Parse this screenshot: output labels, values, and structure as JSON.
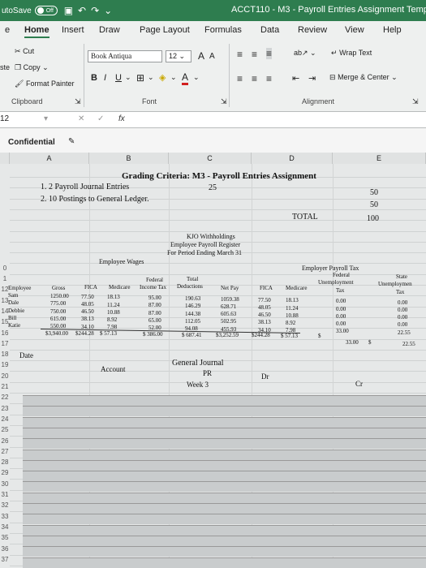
{
  "titlebar": {
    "autosave_label": "utoSave",
    "toggle_label": "Off",
    "title": "ACCT110 - M3 - Payroll Entries Assignment Template"
  },
  "tabs": [
    "e",
    "Home",
    "Insert",
    "Draw",
    "Page Layout",
    "Formulas",
    "Data",
    "Review",
    "View",
    "Help"
  ],
  "ribbon": {
    "clipboard": {
      "cut": "Cut",
      "copy": "Copy",
      "paste_partial": "ste",
      "format_painter": "Format Painter",
      "label": "Clipboard"
    },
    "font": {
      "family": "Book Antiqua",
      "size": "12",
      "grow": "A",
      "shrink": "A",
      "bold": "B",
      "italic": "I",
      "underline": "U",
      "font_color": "A",
      "fill_color": "A",
      "label": "Font"
    },
    "alignment": {
      "wrap_text": "Wrap Text",
      "merge_center": "Merge & Center",
      "label": "Alignment"
    }
  },
  "formula_bar": {
    "name_box": "12",
    "cancel": "✕",
    "enter": "✓",
    "fx": "fx",
    "value": ""
  },
  "sensitivity": {
    "label": "Confidential"
  },
  "columns": [
    "A",
    "B",
    "C",
    "D",
    "E"
  ],
  "rows": [
    "",
    "",
    "",
    "",
    "",
    "",
    "",
    "",
    "",
    "0",
    "1",
    "12",
    "13",
    "14",
    "15",
    "16",
    "17",
    "18",
    "19",
    "20",
    "21",
    "22",
    "23",
    "24",
    "25",
    "26",
    "27",
    "28",
    "29",
    "30",
    "31",
    "32",
    "33",
    "34",
    "35",
    "36",
    "37"
  ],
  "sheet": {
    "grading_title": "Grading Criteria: M3 - Payroll Entries Assignment",
    "criteria": [
      {
        "text": "1. 2 Payroll Journal Entries",
        "score": "25",
        "points": "50"
      },
      {
        "text": "2. 10 Postings to General Ledger.",
        "points": "50"
      }
    ],
    "total_label": "TOTAL",
    "total_value": "100",
    "register_lines": [
      "KJO Withholdings",
      "Employee Payroll Register",
      "For Period Ending March 31"
    ],
    "employee_wages_label": "Employee Wages",
    "employer_tax_label": "Employer Payroll Tax",
    "headers": {
      "employee": "Employee",
      "gross": "Gross",
      "fica": "FICA",
      "medicare": "Medicare",
      "federal_top": "Federal",
      "federal_bottom": "Income Tax",
      "total_top": "Total",
      "total_bottom": "Deductions",
      "net_pay": "Net Pay",
      "er_fica": "FICA",
      "er_medicare": "Medicare",
      "fed_unemp_top": "Federal",
      "fed_unemp_mid": "Unemployment",
      "fed_unemp_bottom": "Tax",
      "state_top": "State",
      "state_mid": "Unemploymen",
      "state_bottom": "Tax"
    },
    "employees": [
      {
        "name": "Sam",
        "gross": "1250.00",
        "fica": "77.50",
        "medicare": "18.13",
        "federal": "95.00",
        "total": "190.63",
        "net": "1059.38",
        "er_fica": "77.50",
        "er_medicare": "18.13",
        "fed_unemp": "0.00",
        "state_unemp": "0.00"
      },
      {
        "name": "Dale",
        "gross": "775.00",
        "fica": "48.05",
        "medicare": "11.24",
        "federal": "87.00",
        "total": "146.29",
        "net": "628.71",
        "er_fica": "48.05",
        "er_medicare": "11.24",
        "fed_unemp": "0.00",
        "state_unemp": "0.00"
      },
      {
        "name": "Debbie",
        "gross": "750.00",
        "fica": "46.50",
        "medicare": "10.88",
        "federal": "87.00",
        "total": "144.38",
        "net": "605.63",
        "er_fica": "46.50",
        "er_medicare": "10.88",
        "fed_unemp": "0.00",
        "state_unemp": "0.00"
      },
      {
        "name": "Bill",
        "gross": "615.00",
        "fica": "38.13",
        "medicare": "8.92",
        "federal": "65.00",
        "total": "112.05",
        "net": "502.95",
        "er_fica": "38.13",
        "er_medicare": "8.92",
        "fed_unemp": "0.00",
        "state_unemp": "0.00"
      },
      {
        "name": "Katie",
        "gross": "550.00",
        "fica": "34.10",
        "medicare": "7.98",
        "federal": "52.00",
        "total": "94.08",
        "net": "455.93",
        "er_fica": "34.10",
        "er_medicare": "7.98",
        "fed_unemp": "33.00",
        "state_unemp": "22.55"
      }
    ],
    "totals": {
      "gross": "$3,940.00",
      "fica": "$244.28",
      "medicare": "$ 57.13",
      "federal": "$ 386.00",
      "total": "$ 687.41",
      "net": "$3,252.59",
      "er_fica": "$244.28",
      "er_medicare": "$ 57.13",
      "fed_unemp_sym": "$",
      "fed_unemp": "33.00",
      "state_unemp_sym": "$",
      "state_unemp": "22.55"
    },
    "journal": {
      "title": "General Journal",
      "date": "Date",
      "account": "Account",
      "pr": "PR",
      "dr": "Dr",
      "cr": "Cr",
      "week": "Week 3"
    }
  }
}
